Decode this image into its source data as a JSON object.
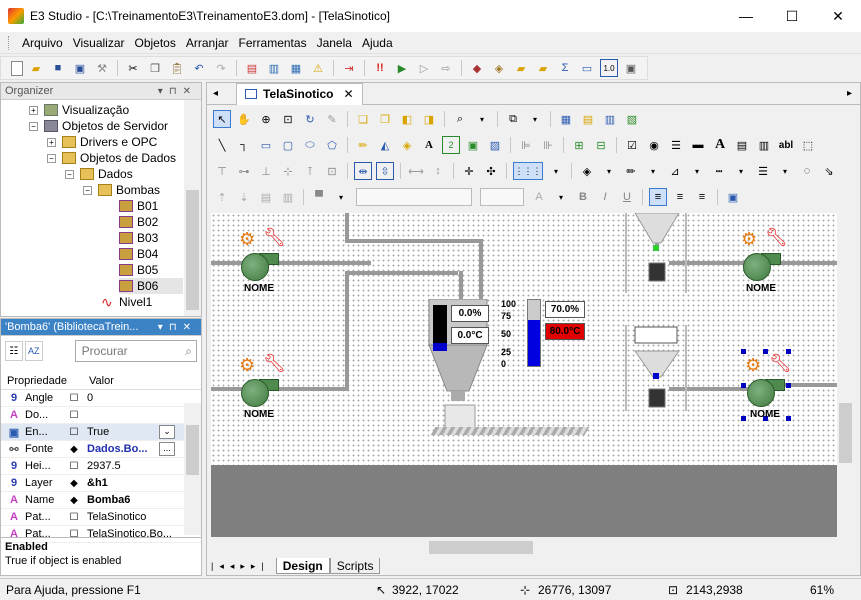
{
  "window": {
    "title": "E3 Studio - [C:\\TreinamentoE3\\TreinamentoE3.dom] - [TelaSinotico]",
    "minimize": "—",
    "maximize": "☐",
    "close": "✕"
  },
  "menu": [
    "Arquivo",
    "Visualizar",
    "Objetos",
    "Arranjar",
    "Ferramentas",
    "Janela",
    "Ajuda"
  ],
  "organizer": {
    "title": "Organizer",
    "items": [
      {
        "label": "Visualização",
        "expander": "+"
      },
      {
        "label": "Objetos de Servidor",
        "expander": "−"
      },
      {
        "label": "Drivers e OPC",
        "expander": "+"
      },
      {
        "label": "Objetos de Dados",
        "expander": "−"
      },
      {
        "label": "Dados",
        "expander": "−"
      },
      {
        "label": "Bombas",
        "expander": "−"
      },
      {
        "label": "B01",
        "expander": ""
      },
      {
        "label": "B02",
        "expander": ""
      },
      {
        "label": "B03",
        "expander": ""
      },
      {
        "label": "B04",
        "expander": ""
      },
      {
        "label": "B05",
        "expander": ""
      },
      {
        "label": "B06",
        "expander": ""
      },
      {
        "label": "Nivel1",
        "expander": ""
      }
    ]
  },
  "properties": {
    "title": "'Bomba6' (BibliotecaTrein...",
    "search_placeholder": "Procurar",
    "col_property": "Propriedade",
    "col_value": "Valor",
    "rows": [
      {
        "icon": "9",
        "name": "Angle",
        "value": "0"
      },
      {
        "icon": "A",
        "name": "Do...",
        "value": ""
      },
      {
        "icon": "▣",
        "name": "En...",
        "value": "True"
      },
      {
        "icon": "⚯",
        "name": "Fonte",
        "value": "Dados.Bo..."
      },
      {
        "icon": "9",
        "name": "Hei...",
        "value": "2937.5"
      },
      {
        "icon": "9",
        "name": "Layer",
        "value": "&h1"
      },
      {
        "icon": "A",
        "name": "Name",
        "value": "Bomba6"
      },
      {
        "icon": "A",
        "name": "Pat...",
        "value": "TelaSinotico"
      },
      {
        "icon": "A",
        "name": "Pat...",
        "value": "TelaSinotico.Bo..."
      }
    ],
    "desc_title": "Enabled",
    "desc_text": "True if object is enabled"
  },
  "document": {
    "tab_label": "TelaSinotico",
    "tab_close": "✕",
    "bottom_tabs": [
      "Design",
      "Scripts"
    ],
    "pump_label": "NOME",
    "tank_level": "0.0%",
    "tank_temp": "0.0°C",
    "gauge_level": "70.0%",
    "gauge_temp": "80.0°C",
    "scale": [
      "100",
      "75",
      "50",
      "25",
      "0"
    ],
    "gauge_fill_percent": 70,
    "colors": {
      "pump": "#4f8a4f",
      "alarm": "#e00000",
      "level": "#0000e0"
    }
  },
  "status": {
    "help": "Para Ajuda, pressione F1",
    "cursor": "3922, 17022",
    "position": "26776, 13097",
    "size": "2143,2938",
    "zoom": "61%"
  }
}
